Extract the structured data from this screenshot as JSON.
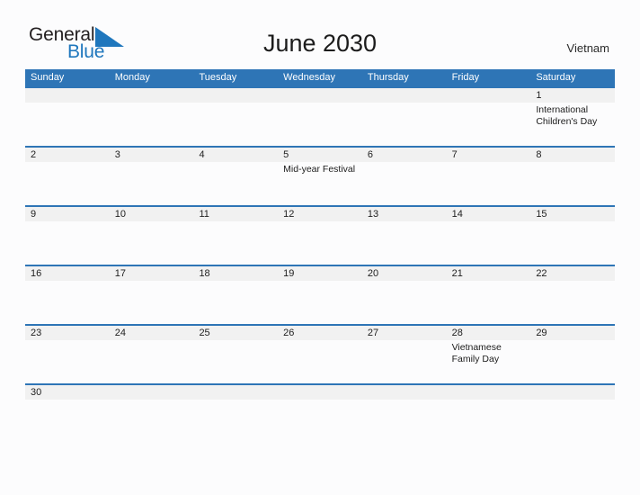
{
  "brand": {
    "name_part1": "General",
    "name_part2": "Blue",
    "triangle_color": "#1f77bd",
    "text_color": "#231f20"
  },
  "header": {
    "title": "June 2030",
    "region": "Vietnam"
  },
  "theme": {
    "header_blue": "#2e75b6",
    "day_band_gray": "#f1f1f1",
    "page_background": "#fcfcfd",
    "text_color": "#212121"
  },
  "calendar": {
    "weekdays": [
      "Sunday",
      "Monday",
      "Tuesday",
      "Wednesday",
      "Thursday",
      "Friday",
      "Saturday"
    ],
    "weeks": [
      {
        "days": [
          {
            "num": "",
            "events": []
          },
          {
            "num": "",
            "events": []
          },
          {
            "num": "",
            "events": []
          },
          {
            "num": "",
            "events": []
          },
          {
            "num": "",
            "events": []
          },
          {
            "num": "",
            "events": []
          },
          {
            "num": "1",
            "events": [
              "International Children's Day"
            ]
          }
        ]
      },
      {
        "days": [
          {
            "num": "2",
            "events": []
          },
          {
            "num": "3",
            "events": []
          },
          {
            "num": "4",
            "events": []
          },
          {
            "num": "5",
            "events": [
              "Mid-year Festival"
            ]
          },
          {
            "num": "6",
            "events": []
          },
          {
            "num": "7",
            "events": []
          },
          {
            "num": "8",
            "events": []
          }
        ]
      },
      {
        "days": [
          {
            "num": "9",
            "events": []
          },
          {
            "num": "10",
            "events": []
          },
          {
            "num": "11",
            "events": []
          },
          {
            "num": "12",
            "events": []
          },
          {
            "num": "13",
            "events": []
          },
          {
            "num": "14",
            "events": []
          },
          {
            "num": "15",
            "events": []
          }
        ]
      },
      {
        "days": [
          {
            "num": "16",
            "events": []
          },
          {
            "num": "17",
            "events": []
          },
          {
            "num": "18",
            "events": []
          },
          {
            "num": "19",
            "events": []
          },
          {
            "num": "20",
            "events": []
          },
          {
            "num": "21",
            "events": []
          },
          {
            "num": "22",
            "events": []
          }
        ]
      },
      {
        "days": [
          {
            "num": "23",
            "events": []
          },
          {
            "num": "24",
            "events": []
          },
          {
            "num": "25",
            "events": []
          },
          {
            "num": "26",
            "events": []
          },
          {
            "num": "27",
            "events": []
          },
          {
            "num": "28",
            "events": [
              "Vietnamese Family Day"
            ]
          },
          {
            "num": "29",
            "events": []
          }
        ]
      },
      {
        "days": [
          {
            "num": "30",
            "events": []
          },
          {
            "num": "",
            "events": []
          },
          {
            "num": "",
            "events": []
          },
          {
            "num": "",
            "events": []
          },
          {
            "num": "",
            "events": []
          },
          {
            "num": "",
            "events": []
          },
          {
            "num": "",
            "events": []
          }
        ]
      }
    ]
  }
}
